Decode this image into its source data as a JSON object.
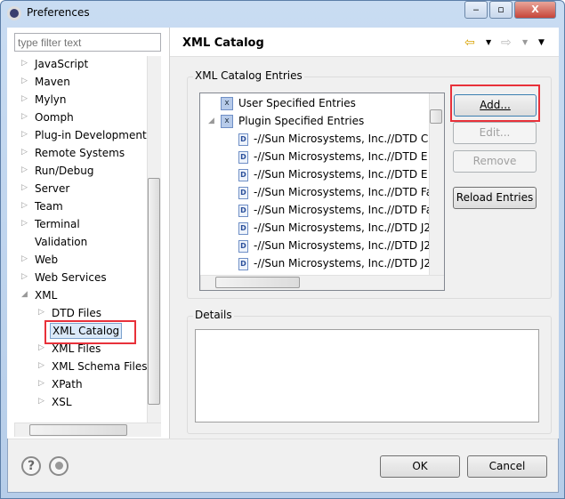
{
  "window": {
    "title": "Preferences",
    "minimize": "‒",
    "maximize": "▫",
    "close": "X"
  },
  "filter": {
    "placeholder": "type filter text"
  },
  "tree": [
    {
      "label": "JavaScript",
      "level": 1,
      "arrow": "▷"
    },
    {
      "label": "Maven",
      "level": 1,
      "arrow": "▷"
    },
    {
      "label": "Mylyn",
      "level": 1,
      "arrow": "▷"
    },
    {
      "label": "Oomph",
      "level": 1,
      "arrow": "▷"
    },
    {
      "label": "Plug-in Development",
      "level": 1,
      "arrow": "▷"
    },
    {
      "label": "Remote Systems",
      "level": 1,
      "arrow": "▷"
    },
    {
      "label": "Run/Debug",
      "level": 1,
      "arrow": "▷"
    },
    {
      "label": "Server",
      "level": 1,
      "arrow": "▷"
    },
    {
      "label": "Team",
      "level": 1,
      "arrow": "▷"
    },
    {
      "label": "Terminal",
      "level": 1,
      "arrow": "▷"
    },
    {
      "label": "Validation",
      "level": 1,
      "arrow": ""
    },
    {
      "label": "Web",
      "level": 1,
      "arrow": "▷"
    },
    {
      "label": "Web Services",
      "level": 1,
      "arrow": "▷"
    },
    {
      "label": "XML",
      "level": 1,
      "arrow": "◢"
    },
    {
      "label": "DTD Files",
      "level": 2,
      "arrow": "▷"
    },
    {
      "label": "XML Catalog",
      "level": 2,
      "arrow": "",
      "selected": true
    },
    {
      "label": "XML Files",
      "level": 2,
      "arrow": "▷"
    },
    {
      "label": "XML Schema Files",
      "level": 2,
      "arrow": "▷"
    },
    {
      "label": "XPath",
      "level": 2,
      "arrow": "▷"
    },
    {
      "label": "XSL",
      "level": 2,
      "arrow": "▷"
    }
  ],
  "page": {
    "title": "XML Catalog",
    "nav": {
      "back": "⇦",
      "forward": "⇨",
      "dropdown": "▼"
    }
  },
  "catalog": {
    "group_label": "XML Catalog Entries",
    "entries": [
      {
        "label": "User Specified Entries",
        "level": 1,
        "icon": "catalog-icon",
        "arrow": ""
      },
      {
        "label": "Plugin Specified Entries",
        "level": 1,
        "icon": "catalog-icon",
        "arrow": "◢"
      },
      {
        "label": "-//Sun Microsystems, Inc.//DTD C",
        "level": 2,
        "icon": "dtd-icon"
      },
      {
        "label": "-//Sun Microsystems, Inc.//DTD E",
        "level": 2,
        "icon": "dtd-icon"
      },
      {
        "label": "-//Sun Microsystems, Inc.//DTD E",
        "level": 2,
        "icon": "dtd-icon"
      },
      {
        "label": "-//Sun Microsystems, Inc.//DTD Fa",
        "level": 2,
        "icon": "dtd-icon"
      },
      {
        "label": "-//Sun Microsystems, Inc.//DTD Fa",
        "level": 2,
        "icon": "dtd-icon"
      },
      {
        "label": "-//Sun Microsystems, Inc.//DTD J2",
        "level": 2,
        "icon": "dtd-icon"
      },
      {
        "label": "-//Sun Microsystems, Inc.//DTD J2",
        "level": 2,
        "icon": "dtd-icon"
      },
      {
        "label": "-//Sun Microsystems, Inc.//DTD J2",
        "level": 2,
        "icon": "dtd-icon"
      }
    ],
    "buttons": {
      "add": "Add...",
      "edit": "Edit...",
      "remove": "Remove",
      "reload": "Reload Entries"
    }
  },
  "details": {
    "label": "Details"
  },
  "footer": {
    "help": "?",
    "ok": "OK",
    "cancel": "Cancel"
  },
  "colors": {
    "highlight": "#e8313a",
    "selection": "#dbe9f9"
  }
}
